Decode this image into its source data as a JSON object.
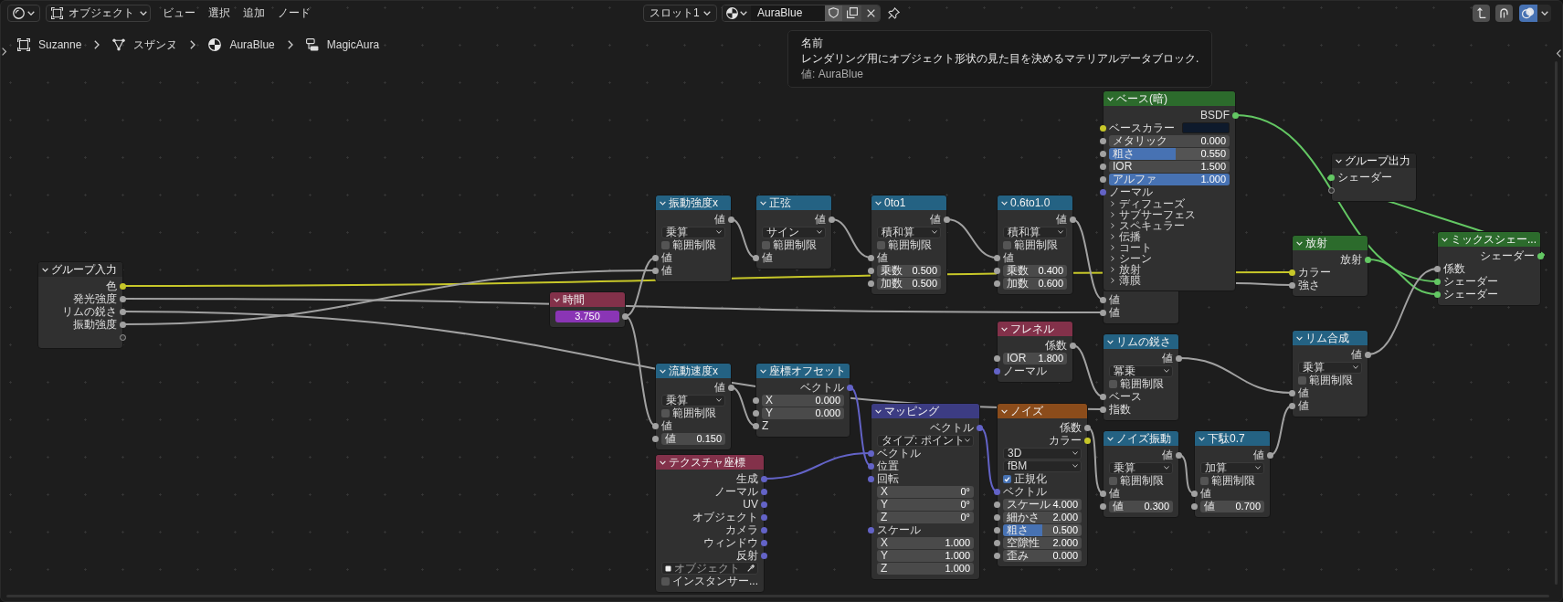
{
  "header": {
    "mode": "オブジェクト",
    "menus": [
      "ビュー",
      "選択",
      "追加",
      "ノード"
    ],
    "slot": "スロット1",
    "material": "AuraBlue",
    "snap": false,
    "overlays": true
  },
  "breadcrumbs": [
    {
      "kind": "object",
      "label": "Suzanne"
    },
    {
      "kind": "mesh",
      "label": "スザンヌ"
    },
    {
      "kind": "material",
      "label": "AuraBlue"
    },
    {
      "kind": "node_tree",
      "label": "MagicAura"
    }
  ],
  "tooltip": {
    "title": "名前",
    "description": "レンダリング用にオブジェクト形状の見た目を決めるマテリアルデータブロック.",
    "value": "値: AuraBlue"
  },
  "nodes": [
    {
      "title": "ベース(暗)",
      "color": "#2c6b2c",
      "rows": [
        {
          "kind": "output",
          "label": "BSDF",
          "socket": {
            "color": "#63c763"
          }
        },
        {
          "kind": "color",
          "label": "ベースカラー",
          "socket": {
            "color": "#c7c729"
          },
          "color": "#0e1a2c"
        },
        {
          "kind": "number",
          "label": "メタリック",
          "value": "0.000",
          "socket": {
            "color": "#a1a1a1"
          }
        },
        {
          "kind": "slider",
          "label": "粗さ",
          "value": "0.550",
          "level": 0.55,
          "socket": {
            "color": "#a1a1a1"
          }
        },
        {
          "kind": "number",
          "label": "IOR",
          "value": "1.500",
          "socket": {
            "color": "#a1a1a1"
          }
        },
        {
          "kind": "slider",
          "label": "アルファ",
          "value": "1.000",
          "level": 1,
          "socket": {
            "color": "#a1a1a1"
          }
        },
        {
          "kind": "input",
          "label": "ノーマル",
          "socket": {
            "color": "#6363c7"
          }
        },
        {
          "kind": "panel",
          "label": "ディフューズ",
          "expanded": false
        },
        {
          "kind": "panel",
          "label": "サブサーフェス",
          "expanded": false
        },
        {
          "kind": "panel",
          "label": "スペキュラー",
          "expanded": false
        },
        {
          "kind": "panel",
          "label": "伝播",
          "expanded": false
        },
        {
          "kind": "panel",
          "label": "コート",
          "expanded": false
        },
        {
          "kind": "panel",
          "label": "シーン",
          "expanded": false
        },
        {
          "kind": "panel",
          "label": "放射",
          "expanded": false
        },
        {
          "kind": "panel",
          "label": "薄膜",
          "expanded": false
        }
      ]
    },
    {
      "title": "グループ出力",
      "color": "#272727",
      "rows": [
        {
          "kind": "input",
          "label": "シェーダー",
          "socket": {
            "color": "#63c763"
          }
        },
        {
          "kind": "empty_in"
        }
      ]
    },
    {
      "title": "振動強度x",
      "color": "#246283",
      "rows": [
        {
          "kind": "output",
          "label": "値",
          "socket": {
            "color": "#a1a1a1"
          }
        },
        {
          "kind": "dropdown",
          "value": "乗算"
        },
        {
          "kind": "checkbox",
          "label": "範囲制限",
          "checked": false
        },
        {
          "kind": "input",
          "label": "値",
          "socket": {
            "color": "#a1a1a1"
          }
        },
        {
          "kind": "input",
          "label": "値",
          "socket": {
            "color": "#a1a1a1"
          }
        }
      ]
    },
    {
      "title": "正弦",
      "color": "#246283",
      "rows": [
        {
          "kind": "output",
          "label": "値",
          "socket": {
            "color": "#a1a1a1"
          }
        },
        {
          "kind": "dropdown",
          "value": "サイン"
        },
        {
          "kind": "checkbox",
          "label": "範囲制限",
          "checked": false
        },
        {
          "kind": "input",
          "label": "値",
          "socket": {
            "color": "#a1a1a1"
          }
        }
      ]
    },
    {
      "title": "0to1",
      "color": "#246283",
      "rows": [
        {
          "kind": "output",
          "label": "値",
          "socket": {
            "color": "#a1a1a1"
          }
        },
        {
          "kind": "dropdown",
          "value": "積和算"
        },
        {
          "kind": "checkbox",
          "label": "範囲制限",
          "checked": false
        },
        {
          "kind": "input",
          "label": "値",
          "socket": {
            "color": "#a1a1a1"
          }
        },
        {
          "kind": "number",
          "label": "乗数",
          "value": "0.500",
          "socket": {
            "color": "#a1a1a1"
          }
        },
        {
          "kind": "number",
          "label": "加数",
          "value": "0.500",
          "socket": {
            "color": "#a1a1a1"
          }
        }
      ]
    },
    {
      "title": "0.6to1.0",
      "color": "#246283",
      "rows": [
        {
          "kind": "output",
          "label": "値",
          "socket": {
            "color": "#a1a1a1"
          }
        },
        {
          "kind": "dropdown",
          "value": "積和算"
        },
        {
          "kind": "checkbox",
          "label": "範囲制限",
          "checked": false
        },
        {
          "kind": "input",
          "label": "値",
          "socket": {
            "color": "#a1a1a1"
          }
        },
        {
          "kind": "number",
          "label": "乗数",
          "value": "0.400",
          "socket": {
            "color": "#a1a1a1"
          }
        },
        {
          "kind": "number",
          "label": "加数",
          "value": "0.600",
          "socket": {
            "color": "#a1a1a1"
          }
        }
      ]
    },
    {
      "rows": [
        {
          "kind": "input",
          "label": "値",
          "socket": {
            "color": "#a1a1a1"
          }
        },
        {
          "kind": "input",
          "label": "値",
          "socket": {
            "color": "#a1a1a1"
          }
        }
      ]
    },
    {
      "title": "放射",
      "color": "#2c6b2c",
      "rows": [
        {
          "kind": "output",
          "label": "放射",
          "socket": {
            "color": "#63c763"
          }
        },
        {
          "kind": "input",
          "label": "カラー",
          "socket": {
            "color": "#c7c729"
          }
        },
        {
          "kind": "input",
          "label": "強さ",
          "socket": {
            "color": "#a1a1a1"
          }
        }
      ]
    },
    {
      "title": "ミックスシェー...",
      "color": "#2c6b2c",
      "rows": [
        {
          "kind": "output",
          "label": "シェーダー",
          "socket": {
            "color": "#63c763"
          }
        },
        {
          "kind": "input",
          "label": "係数",
          "socket": {
            "color": "#a1a1a1"
          }
        },
        {
          "kind": "input",
          "label": "シェーダー",
          "socket": {
            "color": "#63c763"
          }
        },
        {
          "kind": "input",
          "label": "シェーダー",
          "socket": {
            "color": "#63c763"
          }
        }
      ]
    },
    {
      "title": "グループ入力",
      "color": "#272727",
      "rows": [
        {
          "kind": "output",
          "label": "色",
          "socket": {
            "color": "#c7c729"
          }
        },
        {
          "kind": "output",
          "label": "発光強度",
          "socket": {
            "color": "#a1a1a1"
          }
        },
        {
          "kind": "output",
          "label": "リムの鋭さ",
          "socket": {
            "color": "#a1a1a1"
          }
        },
        {
          "kind": "output",
          "label": "振動強度",
          "socket": {
            "color": "#a1a1a1"
          }
        },
        {
          "kind": "empty_out"
        }
      ]
    },
    {
      "title": "時間",
      "color": "#83314a",
      "rows": [
        {
          "kind": "value",
          "value": "3.750",
          "driven": true,
          "socket": {
            "color": "#a1a1a1"
          }
        }
      ]
    },
    {
      "title": "フレネル",
      "color": "#83314a",
      "rows": [
        {
          "kind": "output",
          "label": "係数",
          "socket": {
            "color": "#a1a1a1"
          }
        },
        {
          "kind": "number",
          "label": "IOR",
          "value": "1.800",
          "socket": {
            "color": "#a1a1a1"
          }
        },
        {
          "kind": "input",
          "label": "ノーマル",
          "socket": {
            "color": "#6363c7"
          }
        }
      ]
    },
    {
      "title": "リムの鋭さ",
      "color": "#246283",
      "rows": [
        {
          "kind": "output",
          "label": "値",
          "socket": {
            "color": "#a1a1a1"
          }
        },
        {
          "kind": "dropdown",
          "value": "冪乗"
        },
        {
          "kind": "checkbox",
          "label": "範囲制限",
          "checked": false
        },
        {
          "kind": "input",
          "label": "ベース",
          "socket": {
            "color": "#a1a1a1"
          }
        },
        {
          "kind": "input",
          "label": "指数",
          "socket": {
            "color": "#a1a1a1"
          }
        }
      ]
    },
    {
      "title": "リム合成",
      "color": "#246283",
      "rows": [
        {
          "kind": "output",
          "label": "値",
          "socket": {
            "color": "#a1a1a1"
          }
        },
        {
          "kind": "dropdown",
          "value": "乗算"
        },
        {
          "kind": "checkbox",
          "label": "範囲制限",
          "checked": false
        },
        {
          "kind": "input",
          "label": "値",
          "socket": {
            "color": "#a1a1a1"
          }
        },
        {
          "kind": "input",
          "label": "値",
          "socket": {
            "color": "#a1a1a1"
          }
        }
      ]
    },
    {
      "title": "流動速度x",
      "color": "#246283",
      "rows": [
        {
          "kind": "output",
          "label": "値",
          "socket": {
            "color": "#a1a1a1"
          }
        },
        {
          "kind": "dropdown",
          "value": "乗算"
        },
        {
          "kind": "checkbox",
          "label": "範囲制限",
          "checked": false
        },
        {
          "kind": "input",
          "label": "値",
          "socket": {
            "color": "#a1a1a1"
          }
        },
        {
          "kind": "number",
          "label": "値",
          "value": "0.150",
          "socket": {
            "color": "#a1a1a1"
          }
        }
      ]
    },
    {
      "title": "座標オフセット",
      "color": "#246283",
      "rows": [
        {
          "kind": "output",
          "label": "ベクトル",
          "socket": {
            "color": "#6363c7"
          }
        },
        {
          "kind": "number",
          "label": "X",
          "value": "0.000",
          "socket": {
            "color": "#a1a1a1"
          }
        },
        {
          "kind": "number",
          "label": "Y",
          "value": "0.000",
          "socket": {
            "color": "#a1a1a1"
          }
        },
        {
          "kind": "input",
          "label": "Z",
          "socket": {
            "color": "#a1a1a1"
          }
        }
      ]
    },
    {
      "title": "ノイズ振動",
      "color": "#246283",
      "rows": [
        {
          "kind": "output",
          "label": "値",
          "socket": {
            "color": "#a1a1a1"
          }
        },
        {
          "kind": "dropdown",
          "value": "乗算"
        },
        {
          "kind": "checkbox",
          "label": "範囲制限",
          "checked": false
        },
        {
          "kind": "input",
          "label": "値",
          "socket": {
            "color": "#a1a1a1"
          }
        },
        {
          "kind": "number",
          "label": "値",
          "value": "0.300",
          "socket": {
            "color": "#a1a1a1"
          }
        }
      ]
    },
    {
      "title": "下駄0.7",
      "color": "#246283",
      "rows": [
        {
          "kind": "output",
          "label": "値",
          "socket": {
            "color": "#a1a1a1"
          }
        },
        {
          "kind": "dropdown",
          "value": "加算"
        },
        {
          "kind": "checkbox",
          "label": "範囲制限",
          "checked": false
        },
        {
          "kind": "input",
          "label": "値",
          "socket": {
            "color": "#a1a1a1"
          }
        },
        {
          "kind": "number",
          "label": "値",
          "value": "0.700",
          "socket": {
            "color": "#a1a1a1"
          }
        }
      ]
    },
    {
      "title": "マッピング",
      "color": "#3c3c83",
      "rows": [
        {
          "kind": "output",
          "label": "ベクトル",
          "socket": {
            "color": "#6363c7"
          }
        },
        {
          "kind": "dropdown",
          "value": "タイプ: ポイント"
        },
        {
          "kind": "input",
          "label": "ベクトル",
          "socket": {
            "color": "#6363c7"
          }
        },
        {
          "kind": "input",
          "label": "位置",
          "socket": {
            "color": "#6363c7"
          }
        },
        {
          "kind": "input",
          "label": "回転",
          "socket": {
            "color": "#6363c7"
          }
        },
        {
          "kind": "number",
          "label": "X",
          "value": "0°"
        },
        {
          "kind": "number",
          "label": "Y",
          "value": "0°"
        },
        {
          "kind": "number",
          "label": "Z",
          "value": "0°"
        },
        {
          "kind": "input",
          "label": "スケール",
          "socket": {
            "color": "#6363c7"
          }
        },
        {
          "kind": "number",
          "label": "X",
          "value": "1.000"
        },
        {
          "kind": "number",
          "label": "Y",
          "value": "1.000"
        },
        {
          "kind": "number",
          "label": "Z",
          "value": "1.000"
        }
      ]
    },
    {
      "title": "ノイズ",
      "color": "#8b4c1b",
      "rows": [
        {
          "kind": "output",
          "label": "係数",
          "socket": {
            "color": "#a1a1a1"
          }
        },
        {
          "kind": "output",
          "label": "カラー",
          "socket": {
            "color": "#c7c729"
          }
        },
        {
          "kind": "dropdown",
          "value": "3D"
        },
        {
          "kind": "dropdown",
          "value": "fBM"
        },
        {
          "kind": "checkbox",
          "label": "正規化",
          "checked": true
        },
        {
          "kind": "input",
          "label": "ベクトル",
          "socket": {
            "color": "#6363c7"
          }
        },
        {
          "kind": "number",
          "label": "スケール",
          "value": "4.000",
          "socket": {
            "color": "#a1a1a1"
          }
        },
        {
          "kind": "number",
          "label": "細かさ",
          "value": "2.000",
          "socket": {
            "color": "#a1a1a1"
          }
        },
        {
          "kind": "slider",
          "label": "粗さ",
          "value": "0.500",
          "level": 0.5,
          "socket": {
            "color": "#a1a1a1"
          }
        },
        {
          "kind": "number",
          "label": "空隙性",
          "value": "2.000",
          "socket": {
            "color": "#a1a1a1"
          }
        },
        {
          "kind": "number",
          "label": "歪み",
          "value": "0.000",
          "socket": {
            "color": "#a1a1a1"
          }
        }
      ]
    },
    {
      "title": "テクスチャ座標",
      "color": "#83314a",
      "rows": [
        {
          "kind": "output",
          "label": "生成",
          "socket": {
            "color": "#6363c7"
          }
        },
        {
          "kind": "output",
          "label": "ノーマル",
          "socket": {
            "color": "#6363c7"
          }
        },
        {
          "kind": "output",
          "label": "UV",
          "socket": {
            "color": "#6363c7"
          }
        },
        {
          "kind": "output",
          "label": "オブジェクト",
          "socket": {
            "color": "#6363c7"
          }
        },
        {
          "kind": "output",
          "label": "カメラ",
          "socket": {
            "color": "#6363c7"
          }
        },
        {
          "kind": "output",
          "label": "ウィンドウ",
          "socket": {
            "color": "#6363c7"
          }
        },
        {
          "kind": "output",
          "label": "反射",
          "socket": {
            "color": "#6363c7"
          }
        },
        {
          "kind": "object",
          "placeholder": "オブジェクト"
        },
        {
          "kind": "checkbox",
          "label": "インスタンサー...",
          "checked": false
        }
      ]
    }
  ]
}
